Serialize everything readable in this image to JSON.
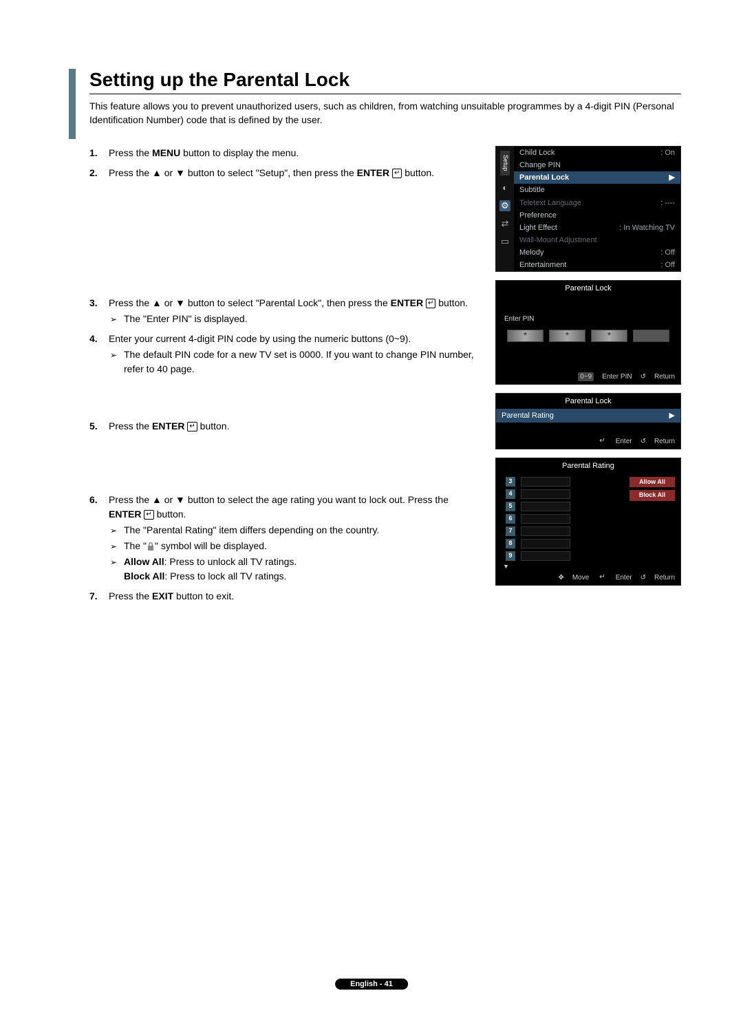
{
  "title": "Setting up the Parental Lock",
  "intro": "This feature allows you to prevent unauthorized users, such as children, from watching unsuitable programmes by a 4-digit PIN (Personal Identification Number) code that is defined by the user.",
  "steps": {
    "s1_a": "Press the ",
    "s1_b": "MENU",
    "s1_c": " button to display the menu.",
    "s2_a": "Press the ▲ or ▼ button to select \"Setup\", then press the ",
    "s2_b": "ENTER",
    "s2_c": " button.",
    "s3_a": "Press the ▲ or ▼ button to select \"Parental Lock\", then press the ",
    "s3_b": "ENTER",
    "s3_c": " button.",
    "s3_sub1": "The \"Enter PIN\" is displayed.",
    "s4_a": "Enter your current 4-digit PIN code by using the numeric buttons (0~9).",
    "s4_sub1": "The default PIN code for a new TV set is 0000. If you want to change PIN number, refer to 40 page.",
    "s5_a": "Press the ",
    "s5_b": "ENTER",
    "s5_c": " button.",
    "s6_a": "Press the ▲ or ▼ button to select the age rating you want to lock out. Press the ",
    "s6_b": "ENTER",
    "s6_c": " button.",
    "s6_sub1": "The \"Parental Rating\" item differs depending on the country.",
    "s6_sub2_a": "The \"",
    "s6_sub2_b": "\" symbol will be displayed.",
    "s6_sub3_a": "Allow All",
    "s6_sub3_b": ": Press to unlock all TV ratings.",
    "s6_sub3_c": "Block All",
    "s6_sub3_d": ": Press to lock all TV ratings.",
    "s7_a": "Press the ",
    "s7_b": "EXIT",
    "s7_c": " button to exit."
  },
  "osd1": {
    "tab": "Setup",
    "items": [
      {
        "label": "Child Lock",
        "value": ": On"
      },
      {
        "label": "Change PIN",
        "value": ""
      },
      {
        "label": "Parental Lock",
        "value": "",
        "selected": true,
        "arrow": "▶"
      },
      {
        "label": "Subtitle",
        "value": ""
      },
      {
        "label": "Teletext Language",
        "value": ": ----",
        "dim": true
      },
      {
        "label": "Preference",
        "value": ""
      },
      {
        "label": "Light Effect",
        "value": ": In Watching TV"
      },
      {
        "label": "Wall-Mount Adjustment",
        "value": "",
        "dim": true
      },
      {
        "label": "Melody",
        "value": ": Off"
      },
      {
        "label": "Entertainment",
        "value": ": Off"
      }
    ]
  },
  "osd2": {
    "title": "Parental Lock",
    "enter_pin": "Enter PIN",
    "footer_badge": "0~9",
    "footer_enter": "Enter PIN",
    "footer_return": "Return"
  },
  "osd3": {
    "title": "Parental Lock",
    "item": "Parental Rating",
    "arrow": "▶",
    "footer_enter": "Enter",
    "footer_return": "Return"
  },
  "osd4": {
    "title": "Parental Rating",
    "ratings": [
      "3",
      "4",
      "5",
      "6",
      "7",
      "8",
      "9"
    ],
    "allow": "Allow All",
    "block": "Block All",
    "footer_move": "Move",
    "footer_enter": "Enter",
    "footer_return": "Return"
  },
  "pageNum": "English - 41",
  "glyphs": {
    "enter": "↵",
    "return": "↺",
    "move": "✥",
    "down": "▼"
  }
}
